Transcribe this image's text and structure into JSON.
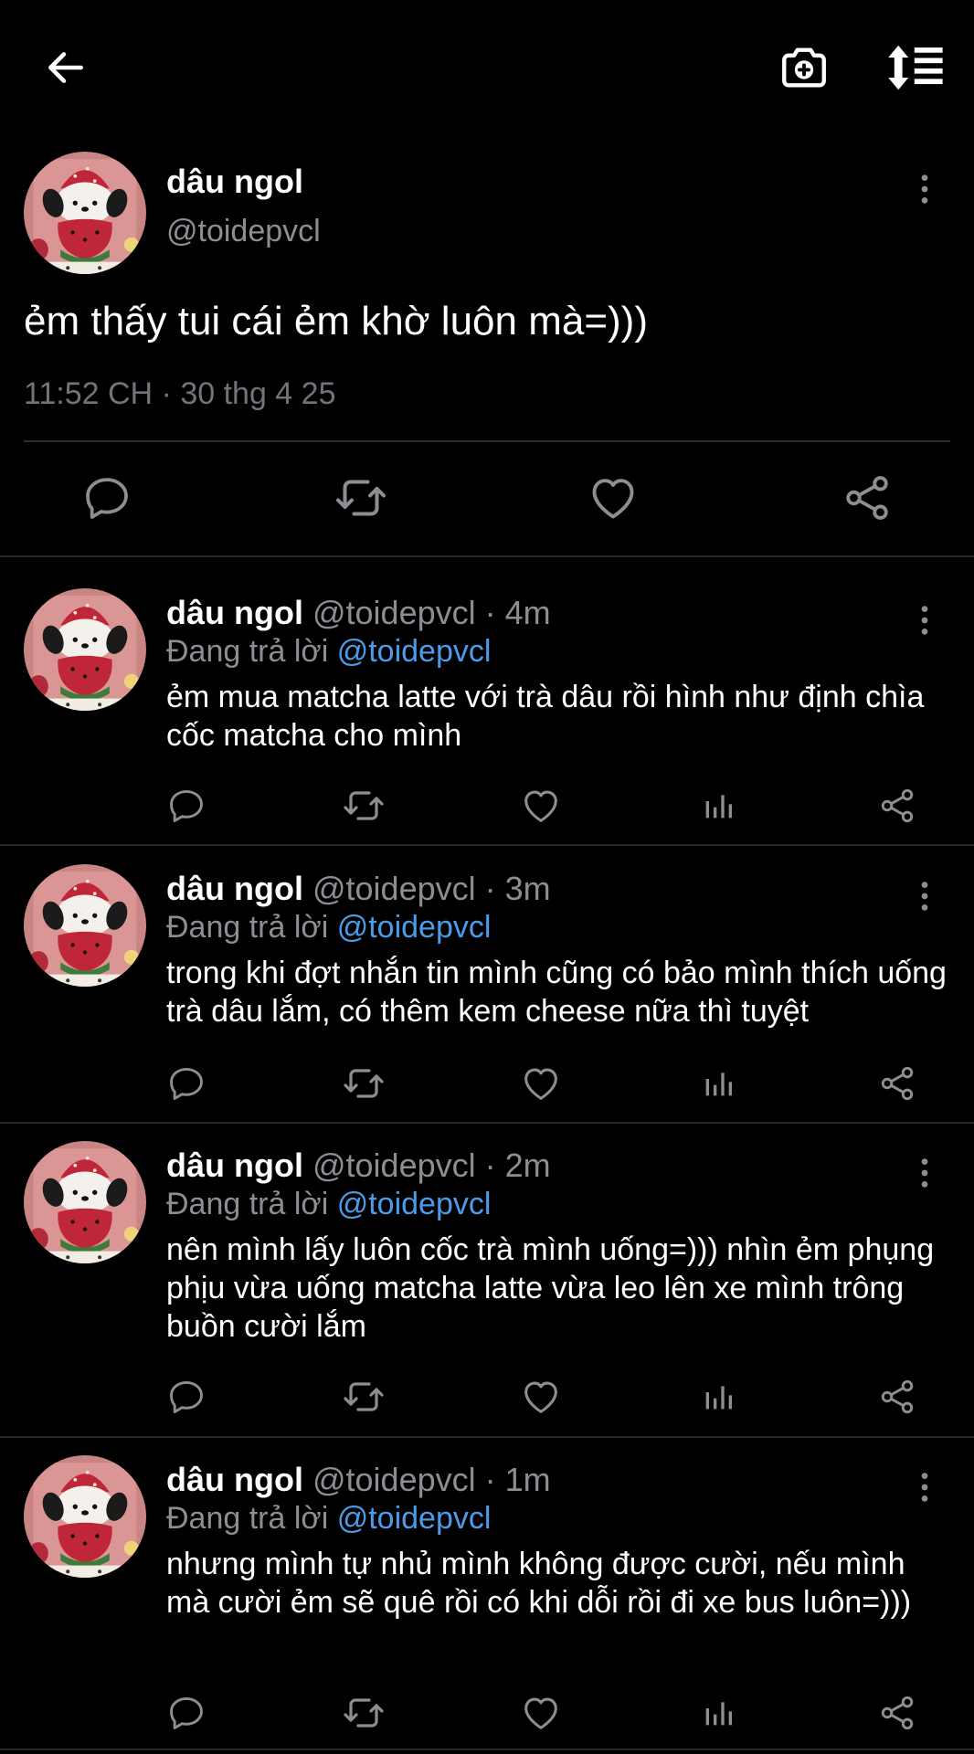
{
  "topbar": {
    "back_icon": "arrow-left-icon",
    "camera_icon": "camera-plus-icon",
    "sort_icon": "sort-list-icon"
  },
  "main_tweet": {
    "name": "dâu ngol",
    "handle": "@toidepvcl",
    "text": "ẻm thấy tui cái ẻm khờ luôn mà=)))",
    "timestamp": "11:52 CH · 30 thg 4 25"
  },
  "replies": [
    {
      "name": "dâu ngol",
      "meta": " @toidepvcl · 4m",
      "reply_prefix": "Đang trả lời ",
      "reply_to": "@toidepvcl",
      "text": "ẻm mua matcha latte với trà dâu rồi hình như định chìa cốc matcha cho mình"
    },
    {
      "name": "dâu ngol",
      "meta": " @toidepvcl · 3m",
      "reply_prefix": "Đang trả lời ",
      "reply_to": "@toidepvcl",
      "text": "trong khi đợt nhắn tin mình cũng có bảo mình thích uống trà dâu lắm, có thêm kem cheese nữa thì tuyệt"
    },
    {
      "name": "dâu ngol",
      "meta": " @toidepvcl · 2m",
      "reply_prefix": "Đang trả lời ",
      "reply_to": "@toidepvcl",
      "text": "nên mình lấy luôn cốc trà mình uống=))) nhìn ẻm phụng phịu vừa uống matcha latte vừa leo lên xe mình trông buồn cười lắm"
    },
    {
      "name": "dâu ngol",
      "meta": " @toidepvcl · 1m",
      "reply_prefix": "Đang trả lời ",
      "reply_to": "@toidepvcl",
      "text": "nhưng mình tự nhủ mình không được cười, nếu mình mà cười ẻm sẽ quê rồi có khi dỗi rồi đi xe bus luôn=)))"
    }
  ],
  "colors": {
    "background": "#000000",
    "secondary_text": "#8b8f94",
    "mention": "#4c9be8",
    "divider": "#25282b"
  }
}
